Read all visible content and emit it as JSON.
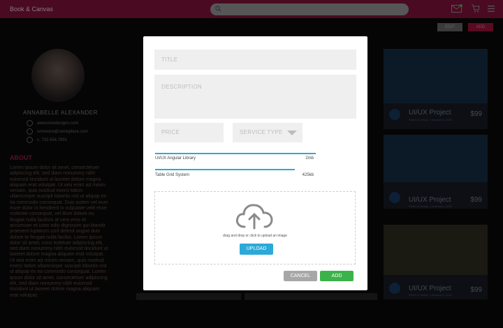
{
  "header": {
    "brand": "Book & Canvas",
    "edit_label": "EDIT",
    "add_label": "ADD"
  },
  "profile": {
    "name": "ANNABELLE ALEXANDER",
    "email": "awesomedesigns.com",
    "email2": "someone@someplace.com",
    "phone": "c. 733.654.7891",
    "about_title": "ABOUT",
    "about_text": "Lorem ipsum dolor sit amet, consectetuer adipiscing elit, sed diam nonummy nibh euismod tincidunt ut laoreet dolore magna aliquam erat volutpat. Ut wisi enim ad minim veniam, quis nostrud exerci tation ullamcorper suscipit lobortis nisl ut aliquip ex ea commodo consequat. Duis autem vel eum iriure dolor in hendrerit in vulputate velit esse molestie consequat, vel illum dolore eu feugiat nulla facilisis at vero eros et accumsan et iusto odio dignissim qui blandit praesent luptatum zzril delenit augue duis dolore te feugait nulla facilisi. Lorem ipsum dolor sit amet, cons ectetuer adipiscing elit, sed diam nonummy nibh euismod tincidunt ut laoreet dolore magna aliquam erat volutpat. Ut wisi enim ad minim veniam, quis nostrud exerci tation ullamcorper suscipit lobortis nisl ut aliquip ex ea commodo consequat. Lorem ipsum dolor sit amet, consectetuer adipiscing elit, sed diam nonummy nibh euismod tincidunt ut laoreet dolore magna aliquam erat volutpat."
  },
  "cards": [
    {
      "title": "UI/UX Project",
      "sub": "React UI design | Javascript | 2016",
      "price": "$99"
    },
    {
      "title": "UI/UX Project",
      "sub": "React UI design | Javascript | 2016",
      "price": "$99"
    },
    {
      "title": "UI/UX Project",
      "sub": "React UI design | Javascript | 2016",
      "price": "$99"
    }
  ],
  "modal": {
    "title_placeholder": "TITLE",
    "description_placeholder": "DESCRIPTION",
    "price_placeholder": "PRICE",
    "service_type_placeholder": "SERVICE TYPE",
    "files": [
      {
        "name": "UI/UX Angular Library",
        "size": "2mb",
        "progress": 1.0
      },
      {
        "name": "Table Grid System",
        "size": "425kb",
        "progress": 0.87
      }
    ],
    "drop_hint": "drag and drop or click to upload an image",
    "upload_label": "UPLOAD",
    "cancel_label": "CANCEL",
    "add_label": "ADD"
  },
  "colors": {
    "header_bg": "#4a0a22",
    "accent_blue": "#2ba9d8",
    "add_green": "#3cb34a",
    "cancel_gray": "#a7a7a7"
  }
}
